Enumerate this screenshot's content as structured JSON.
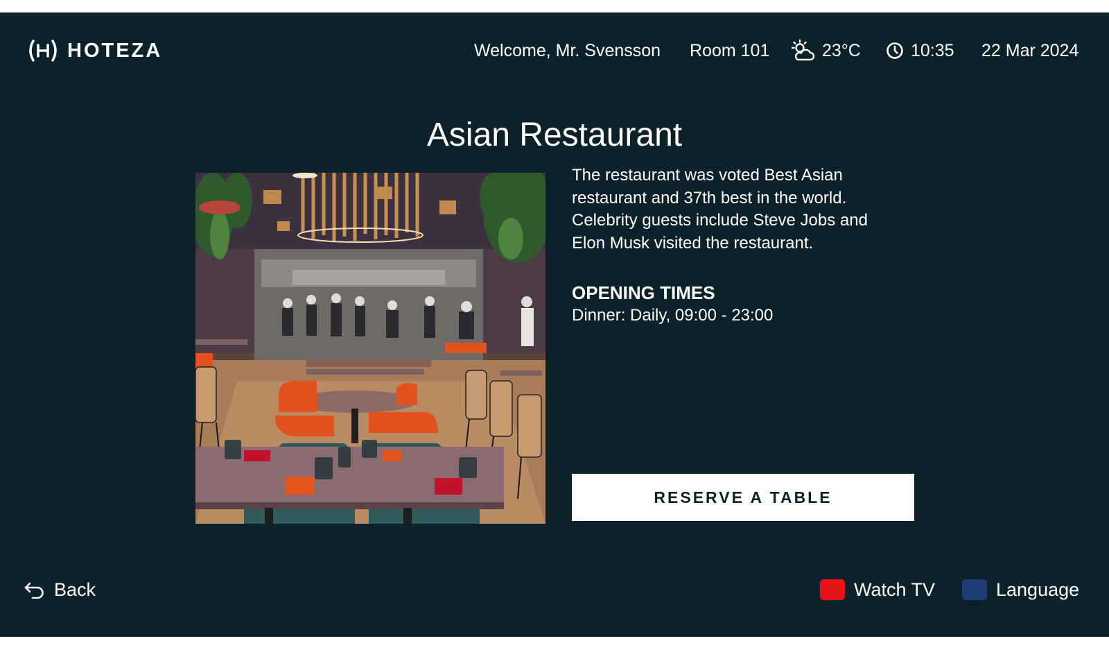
{
  "brand": {
    "name": "HOTEZA"
  },
  "header": {
    "welcome": "Welcome, Mr. Svensson",
    "room": "Room 101",
    "temperature": "23°C",
    "time": "10:35",
    "date": "22 Mar 2024",
    "icons": {
      "weather": "partly-cloudy-icon",
      "time": "clock-icon"
    }
  },
  "restaurant": {
    "title": "Asian Restaurant",
    "description": "The restaurant was voted Best Asian restaurant and 37th best in the world. Celebrity guests include Steve Jobs and Elon Musk visited the restaurant.",
    "opening_title": "OPENING TIMES",
    "opening_hours": "Dinner: Daily, 09:00 - 23:00",
    "reserve_label": "RESERVE A TABLE"
  },
  "footer": {
    "back_label": "Back",
    "watch_tv_label": "Watch TV",
    "language_label": "Language",
    "colors": {
      "watch_tv": "#e8141a",
      "language": "#1c3d78"
    }
  },
  "colors": {
    "background": "#0c212a",
    "text": "#ffffff",
    "button_bg": "#ffffff",
    "button_text": "#0c212a"
  }
}
